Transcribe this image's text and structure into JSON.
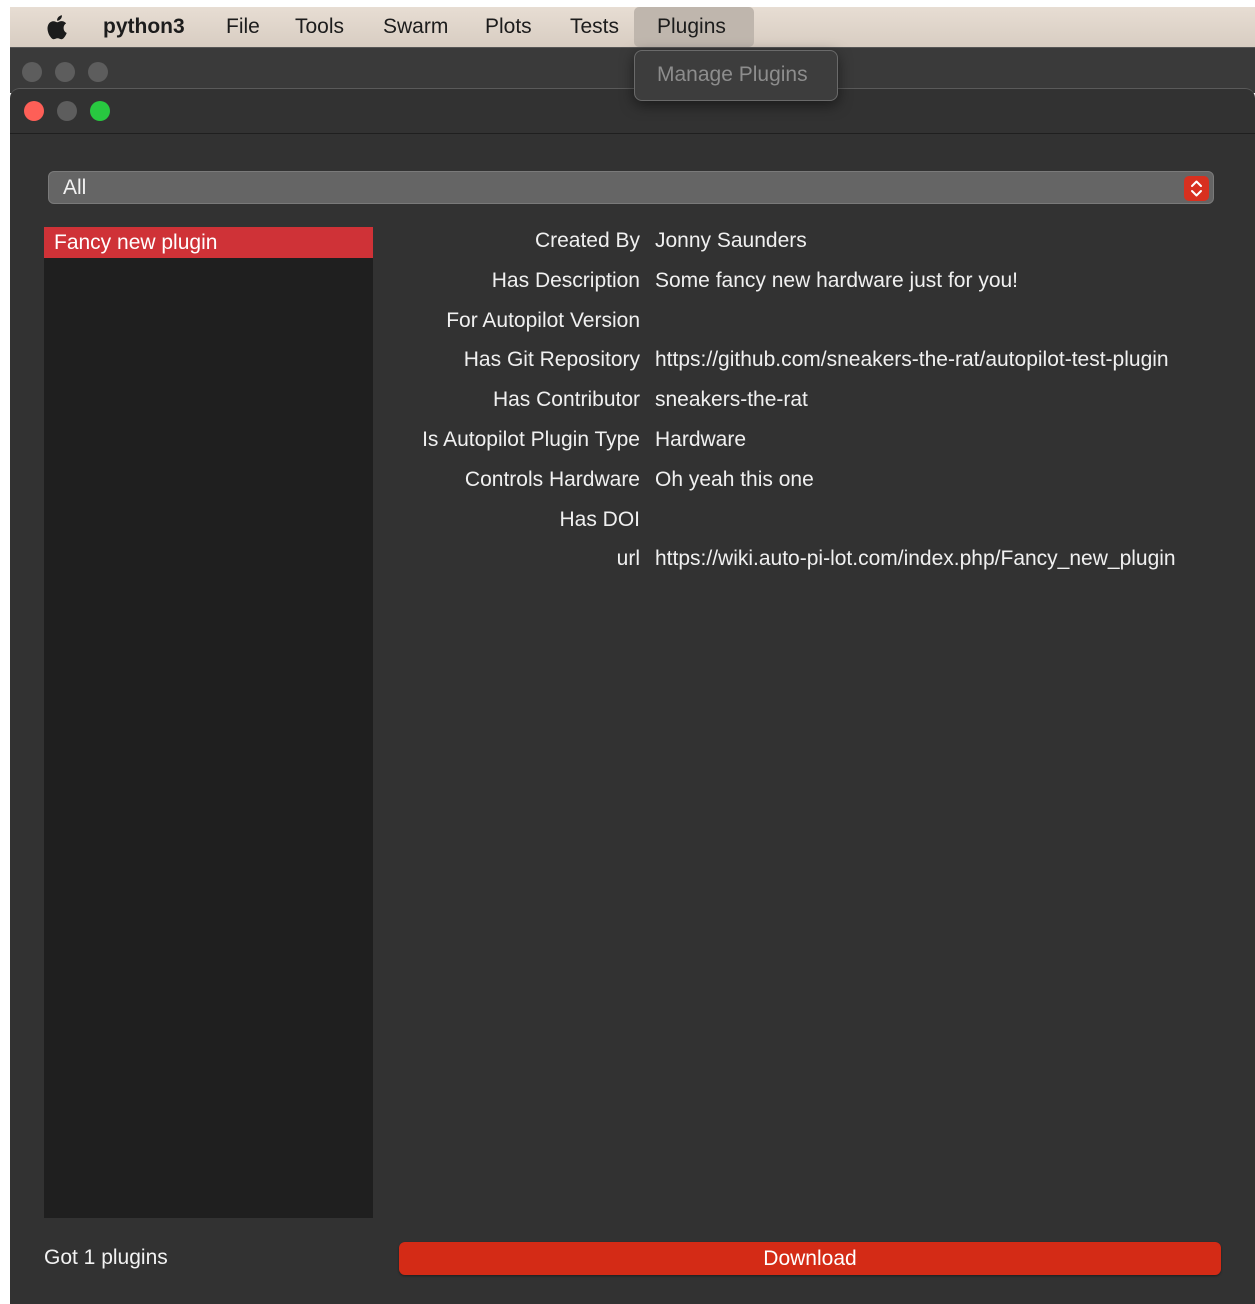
{
  "menubar": {
    "app_name": "python3",
    "items": [
      "File",
      "Tools",
      "Swarm",
      "Plots",
      "Tests",
      "Plugins"
    ],
    "active_menu": "Plugins"
  },
  "dropdown": {
    "items": [
      "Manage Plugins"
    ]
  },
  "filter": {
    "selected": "All"
  },
  "plugin_list": {
    "items": [
      "Fancy new plugin"
    ],
    "selected_index": 0
  },
  "details": [
    {
      "key": "Created By",
      "value": "Jonny Saunders"
    },
    {
      "key": "Has Description",
      "value": "Some fancy new hardware just for you!"
    },
    {
      "key": "For Autopilot Version",
      "value": ""
    },
    {
      "key": "Has Git Repository",
      "value": "https://github.com/sneakers-the-rat/autopilot-test-plugin"
    },
    {
      "key": "Has Contributor",
      "value": "sneakers-the-rat"
    },
    {
      "key": "Is Autopilot Plugin Type",
      "value": "Hardware"
    },
    {
      "key": "Controls Hardware",
      "value": "Oh yeah this one"
    },
    {
      "key": "Has DOI",
      "value": ""
    },
    {
      "key": "url",
      "value": "https://wiki.auto-pi-lot.com/index.php/Fancy_new_plugin"
    }
  ],
  "footer": {
    "status": "Got 1 plugins",
    "download_label": "Download"
  },
  "colors": {
    "accent": "#d42b16",
    "selection": "#cf3237",
    "window_bg": "#323232"
  }
}
